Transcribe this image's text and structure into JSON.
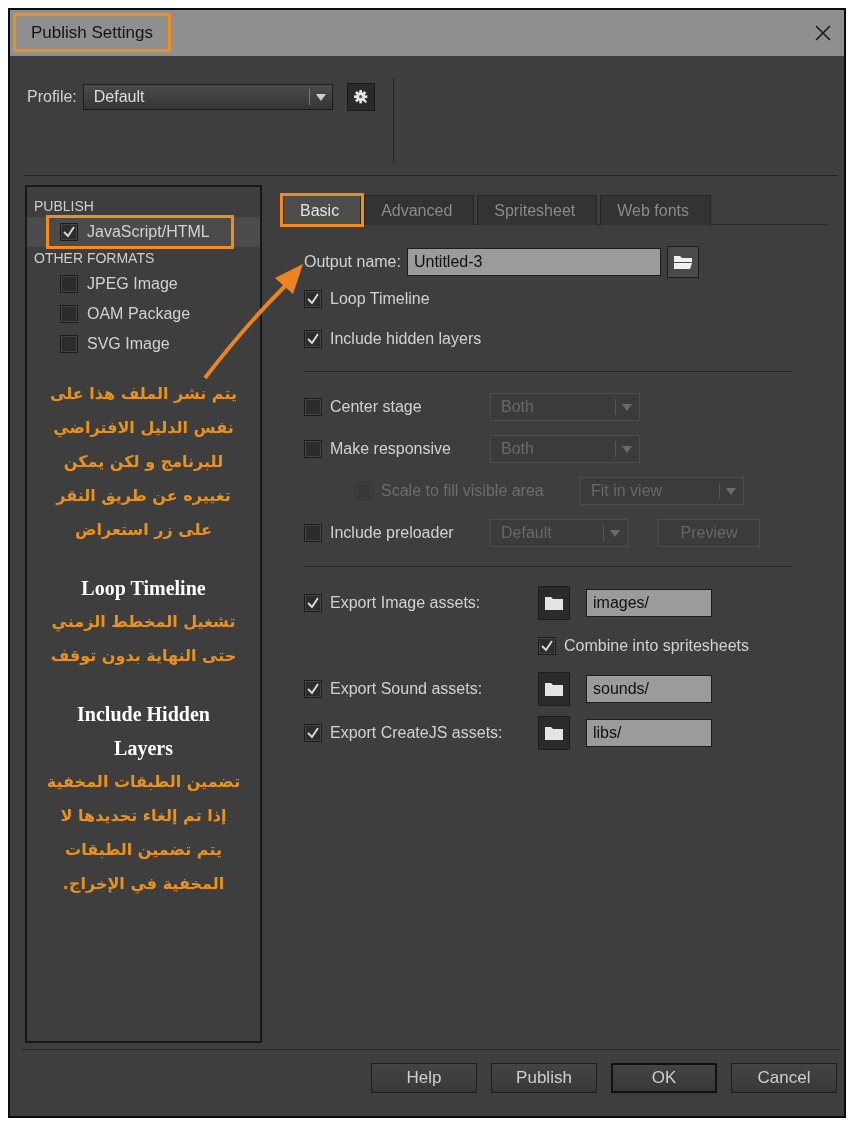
{
  "window": {
    "title": "Publish Settings",
    "highlighted": true
  },
  "profile": {
    "label": "Profile:",
    "value": "Default"
  },
  "sidebar": {
    "sections": [
      {
        "heading": "PUBLISH",
        "items": [
          {
            "label": "JavaScript/HTML",
            "checked": true,
            "selected": true,
            "highlighted": true
          }
        ]
      },
      {
        "heading": "OTHER FORMATS",
        "items": [
          {
            "label": "JPEG Image",
            "checked": false,
            "selected": false,
            "highlighted": false
          },
          {
            "label": "OAM Package",
            "checked": false,
            "selected": false,
            "highlighted": false
          },
          {
            "label": "SVG Image",
            "checked": false,
            "selected": false,
            "highlighted": false
          }
        ]
      }
    ],
    "notes": [
      {
        "kind": "note",
        "text": "يتم نشر الملف هذا على نفس الدليل الافتراضي للبرنامج و لكن يمكن تغييره عن طريق النقر على زر استعراض"
      },
      {
        "kind": "heading",
        "text": "Loop Timeline"
      },
      {
        "kind": "note",
        "text": "تشغيل المخطط الزمني حتى النهاية بدون توقف"
      },
      {
        "kind": "heading",
        "text": "Include Hidden Layers"
      },
      {
        "kind": "note",
        "text": "تضمين الطبقات المخفية إذا تم إلغاء تحديدها لا يتم تضمين الطبقات المخفية في الإخراج."
      }
    ]
  },
  "tabs": [
    {
      "label": "Basic",
      "selected": true,
      "highlighted": true
    },
    {
      "label": "Advanced",
      "selected": false,
      "highlighted": false
    },
    {
      "label": "Spritesheet",
      "selected": false,
      "highlighted": false
    },
    {
      "label": "Web fonts",
      "selected": false,
      "highlighted": false
    }
  ],
  "basic": {
    "output_name": {
      "label": "Output name:",
      "value": "Untitled-3"
    },
    "rows": [
      {
        "kind": "check",
        "label": "Loop Timeline",
        "checked": true
      },
      {
        "kind": "check",
        "label": "Include hidden layers",
        "checked": true
      },
      {
        "kind": "divider"
      },
      {
        "kind": "option",
        "label": "Center stage",
        "checked": false,
        "disabled": false,
        "select": {
          "value": "Both",
          "disabled": true
        }
      },
      {
        "kind": "option",
        "label": "Make responsive",
        "checked": false,
        "disabled": false,
        "select": {
          "value": "Both",
          "disabled": true
        }
      },
      {
        "kind": "suboption",
        "label": "Scale to fill visible area",
        "checked": false,
        "disabled": true,
        "select": {
          "value": "Fit in view",
          "disabled": true
        }
      },
      {
        "kind": "option",
        "label": "Include preloader",
        "checked": false,
        "disabled": false,
        "select": {
          "value": "Default",
          "disabled": true
        },
        "button": {
          "label": "Preview",
          "disabled": true
        }
      },
      {
        "kind": "divider"
      },
      {
        "kind": "export",
        "label": "Export Image assets:",
        "checked": true,
        "path": "images/"
      },
      {
        "kind": "subcheck",
        "label": "Combine into spritesheets",
        "checked": true
      },
      {
        "kind": "export",
        "label": "Export Sound assets:",
        "checked": true,
        "path": "sounds/"
      },
      {
        "kind": "export",
        "label": "Export CreateJS assets:",
        "checked": true,
        "path": "libs/"
      }
    ]
  },
  "buttons": [
    {
      "label": "Help",
      "default": false
    },
    {
      "label": "Publish",
      "default": false
    },
    {
      "label": "OK",
      "default": true
    },
    {
      "label": "Cancel",
      "default": false
    }
  ]
}
